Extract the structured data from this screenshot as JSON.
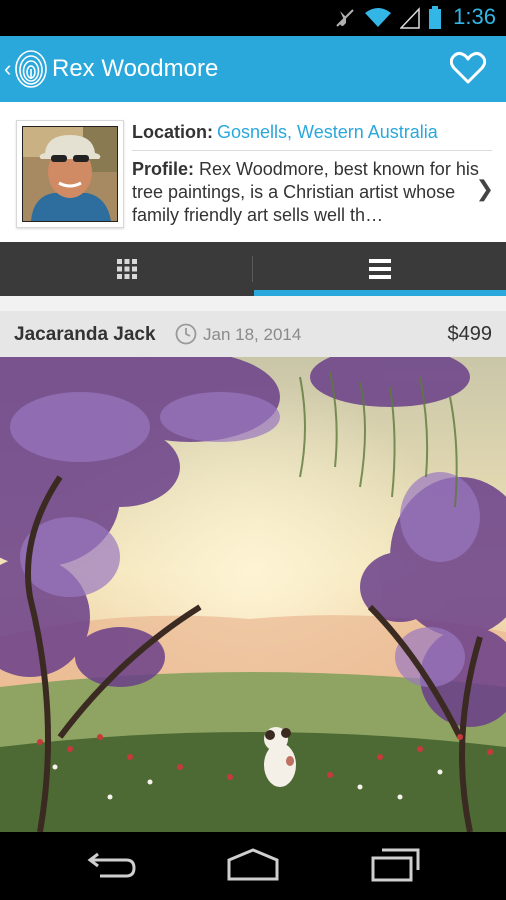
{
  "status_bar": {
    "time": "1:36",
    "icons": [
      "mute-icon",
      "wifi-icon",
      "signal-icon",
      "battery-icon"
    ]
  },
  "action_bar": {
    "title": "Rex Woodmore",
    "icons": [
      "back-icon",
      "fingerprint-logo-icon",
      "heart-icon"
    ]
  },
  "profile": {
    "location_label": "Location:",
    "location_value": "Gosnells, Western Australia",
    "profile_label": "Profile:",
    "profile_text": "Rex Woodmore, best known for his tree paintings, is a Christian artist whose family friendly art sells well th…"
  },
  "tabs": [
    {
      "icon": "grid-icon",
      "selected": false
    },
    {
      "icon": "list-icon",
      "selected": true
    }
  ],
  "artwork": {
    "title": "Jacaranda Jack",
    "date": "Jan 18, 2014",
    "price": "$499"
  },
  "nav_bar": {
    "icons": [
      "back-nav-icon",
      "home-nav-icon",
      "recents-nav-icon"
    ]
  },
  "colors": {
    "accent": "#2aa8dc",
    "tab_bar": "#3a3a3a"
  }
}
